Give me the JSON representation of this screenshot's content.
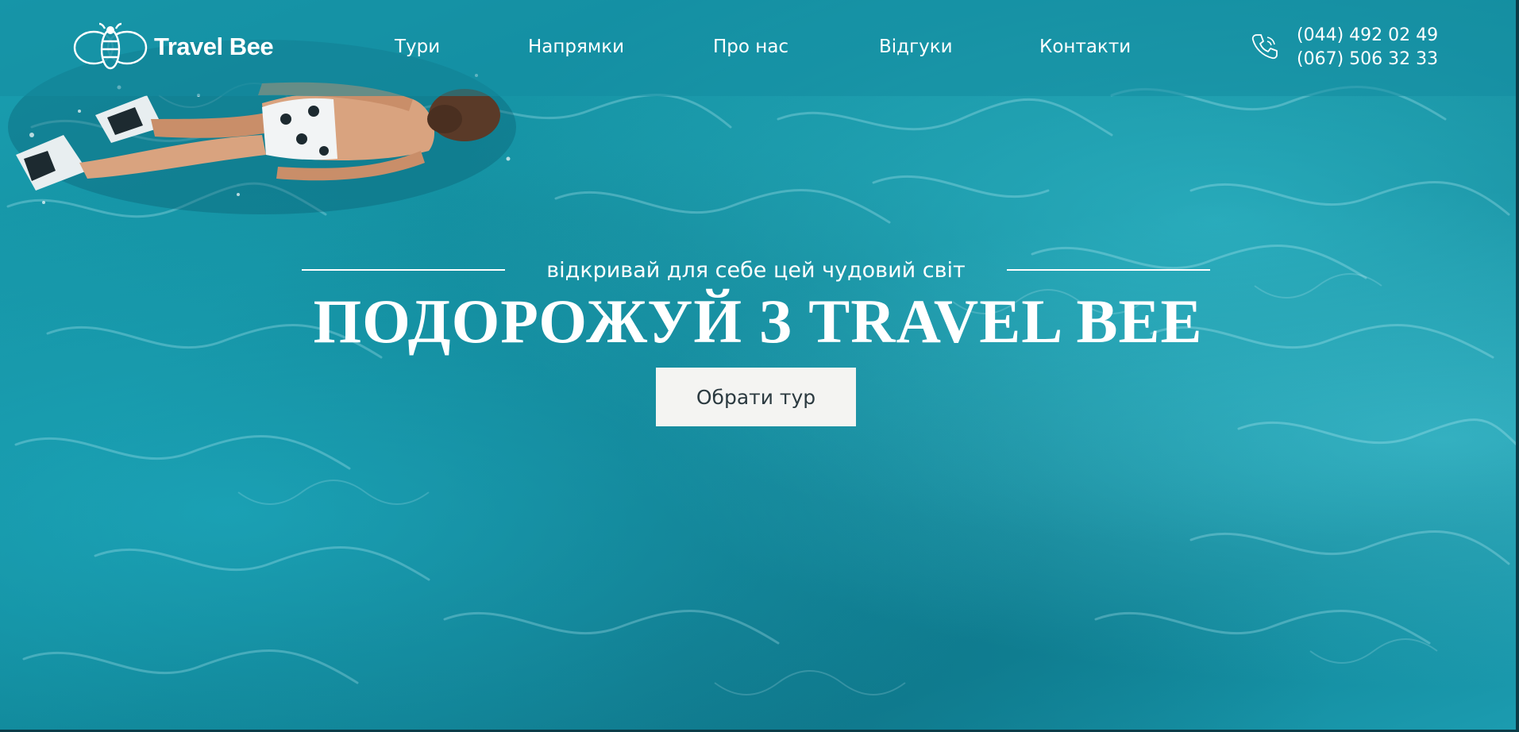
{
  "header": {
    "logo_text": "Travel Bee",
    "nav": [
      {
        "label": "Тури"
      },
      {
        "label": "Напрямки"
      },
      {
        "label": "Про нас"
      },
      {
        "label": "Відгуки"
      },
      {
        "label": "Контакти"
      }
    ],
    "phones": [
      "(044) 492 02 49",
      "(067) 506 32 33"
    ]
  },
  "hero": {
    "tagline": "відкривай для себе цей чудовий світ",
    "headline": "ПОДОРОЖУЙ З TRAVEL BEE",
    "cta_label": "Обрати тур"
  },
  "colors": {
    "water": "#138e9f",
    "header_overlay": "#148ca0",
    "cta_background": "#f4f4f2",
    "cta_text": "#2b3a40",
    "text": "#ffffff"
  },
  "icons": {
    "logo": "bee-icon",
    "phone": "phone-icon"
  }
}
